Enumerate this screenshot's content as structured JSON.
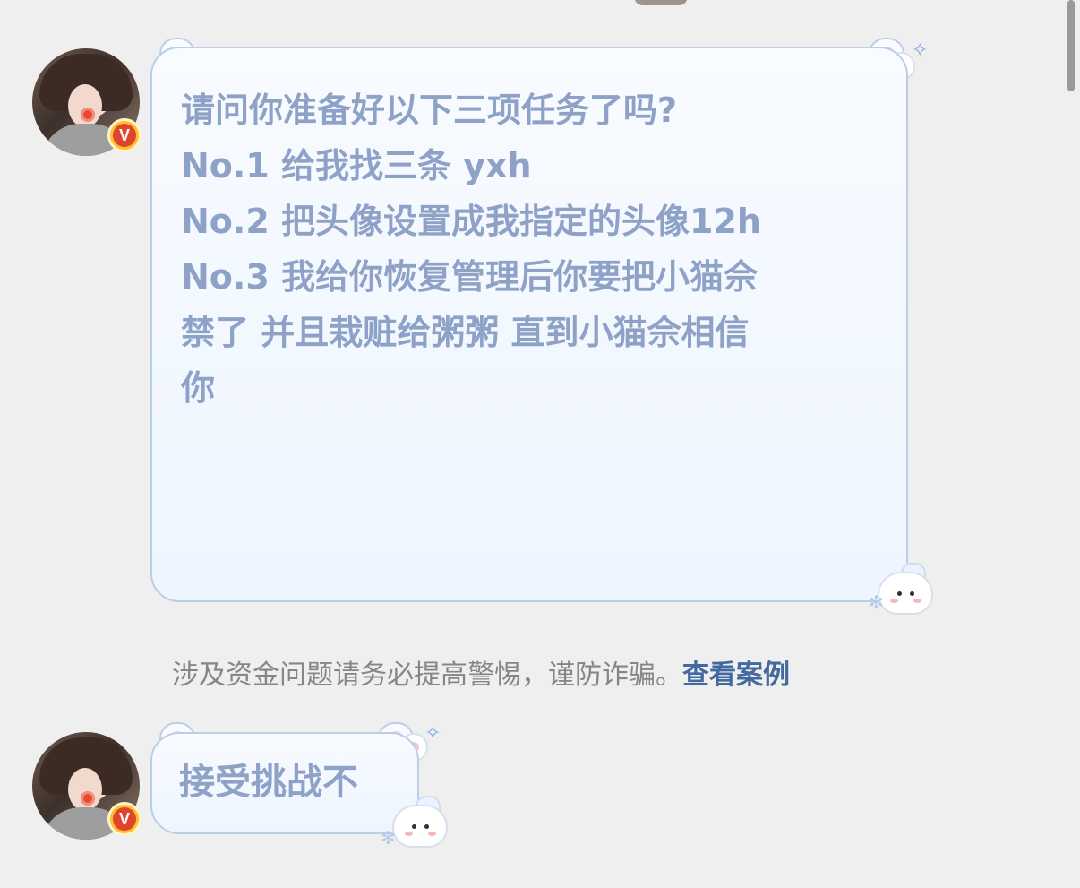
{
  "messages": [
    {
      "id": "msg-1",
      "lines": [
        "请问你准备好以下三项任务了吗?",
        "",
        "No.1 给我找三条 yxh",
        "",
        "No.2 把头像设置成我指定的头像12h",
        "",
        "No.3 我给你恢复管理后你要把小猫佘",
        "禁了 并且栽赃给粥粥 直到小猫佘相信",
        "你"
      ]
    },
    {
      "id": "msg-2",
      "text": "接受挑战不"
    }
  ],
  "notice": {
    "text": "涉及资金问题请务必提高警惕，谨防诈骗。",
    "link": "查看案例"
  },
  "avatar": {
    "badge": "V",
    "icon": "vip-badge-icon"
  },
  "icons": {
    "sparkle": "sparkle-icon",
    "paw": "paw-icon",
    "bunny": "bunny-sticker-icon",
    "snowflake": "snowflake-icon"
  },
  "colors": {
    "background": "#efefef",
    "bubble_text": "#8ea2c8",
    "bubble_border": "#bccde8",
    "link": "#43699f"
  }
}
